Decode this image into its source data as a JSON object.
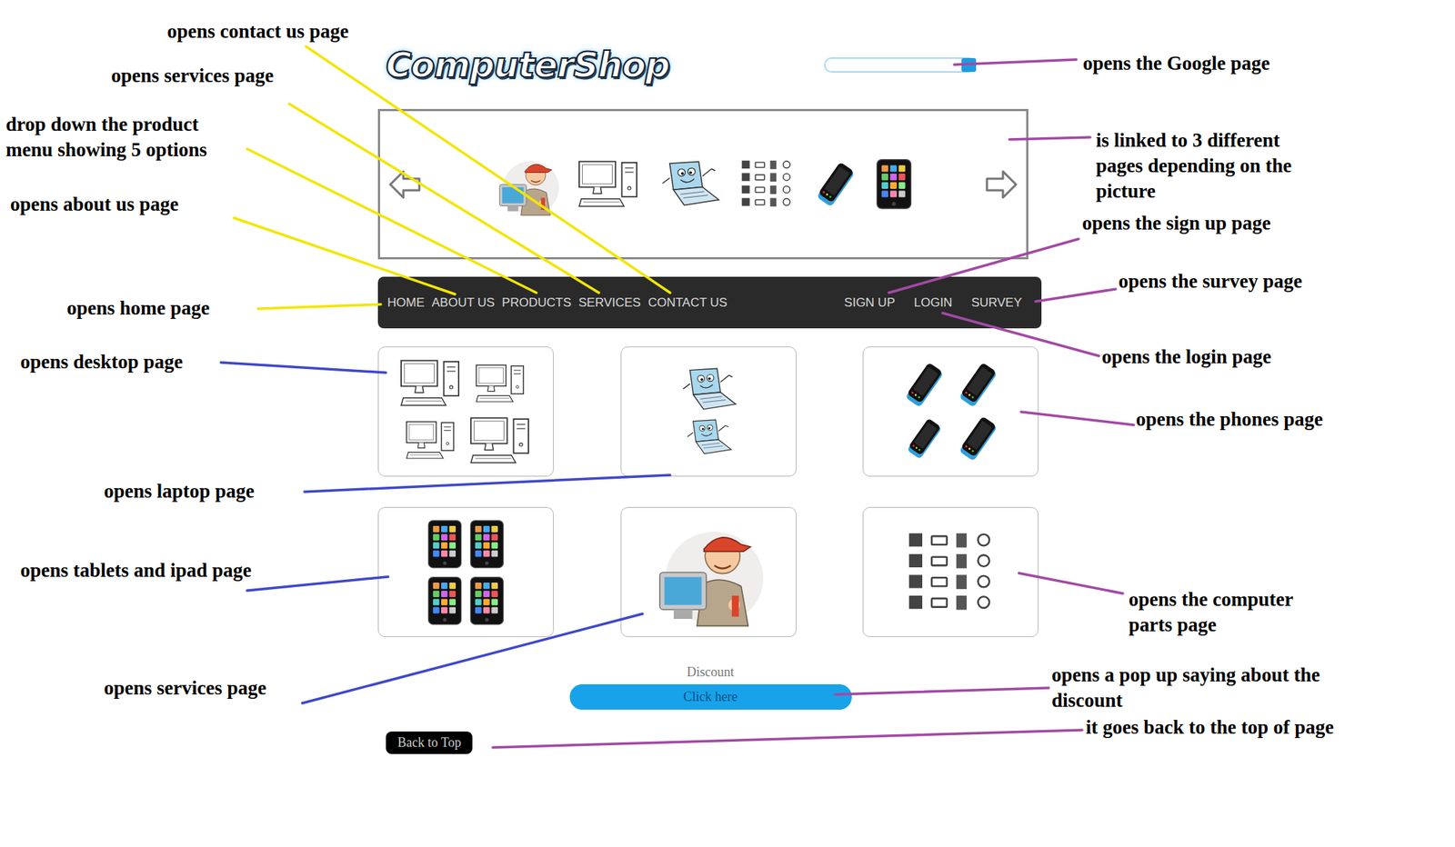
{
  "logo": {
    "text": "ComputerShop"
  },
  "nav": {
    "left": [
      {
        "label": "HOME"
      },
      {
        "label": "ABOUT US"
      },
      {
        "label": "PRODUCTS"
      },
      {
        "label": "SERVICES"
      },
      {
        "label": "CONTACT US"
      }
    ],
    "right": [
      {
        "label": "SIGN UP"
      },
      {
        "label": "LOGIN"
      },
      {
        "label": "SURVEY"
      }
    ]
  },
  "discount": {
    "label": "Discount",
    "button": "Click here"
  },
  "back_to_top": {
    "label": "Back to Top"
  },
  "annotations": [
    {
      "lines": [
        "opens contact us page"
      ],
      "color": "#f2e600"
    },
    {
      "lines": [
        "opens services page"
      ],
      "color": "#f2e600"
    },
    {
      "lines": [
        "drop down the product",
        "menu showing 5 options"
      ],
      "color": "#f2e600"
    },
    {
      "lines": [
        "opens about us page"
      ],
      "color": "#f2e600"
    },
    {
      "lines": [
        "opens home page"
      ],
      "color": "#f2e600"
    },
    {
      "lines": [
        "opens desktop page"
      ],
      "color": "#3f48cc"
    },
    {
      "lines": [
        "opens laptop page"
      ],
      "color": "#3f48cc"
    },
    {
      "lines": [
        "opens tablets and ipad page"
      ],
      "color": "#3f48cc"
    },
    {
      "lines": [
        "opens services page"
      ],
      "color": "#3f48cc"
    },
    {
      "lines": [
        "opens the Google page"
      ],
      "color": "#a349a4"
    },
    {
      "lines": [
        "is linked to 3 different",
        "pages depending on the",
        "picture"
      ],
      "color": "#a349a4"
    },
    {
      "lines": [
        "opens the sign up page"
      ],
      "color": "#a349a4"
    },
    {
      "lines": [
        "opens the survey page"
      ],
      "color": "#a349a4"
    },
    {
      "lines": [
        "opens the login page"
      ],
      "color": "#a349a4"
    },
    {
      "lines": [
        "opens the phones page"
      ],
      "color": "#a349a4"
    },
    {
      "lines": [
        "opens the computer",
        "parts page"
      ],
      "color": "#a349a4"
    },
    {
      "lines": [
        "opens a pop up saying about the",
        "discount"
      ],
      "color": "#a349a4"
    },
    {
      "lines": [
        "it goes back to the top of page"
      ],
      "color": "#a349a4"
    }
  ]
}
